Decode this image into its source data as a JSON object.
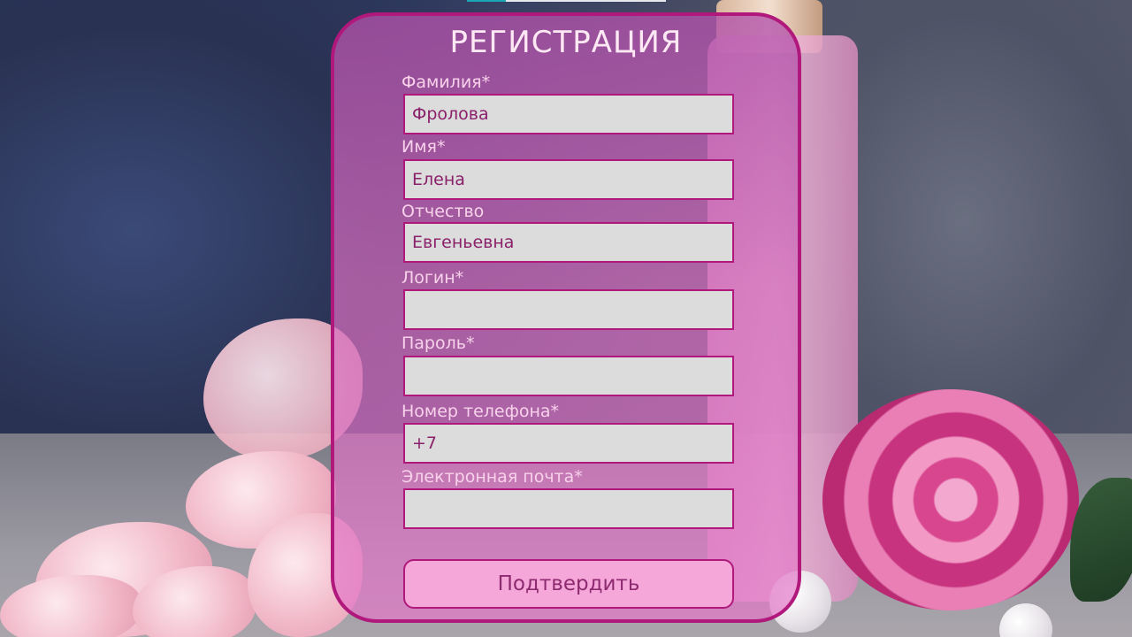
{
  "form": {
    "title": "РЕГИСТРАЦИЯ",
    "fields": [
      {
        "label": "Фамилия*",
        "value": "Фролова"
      },
      {
        "label": "Имя*",
        "value": "Елена"
      },
      {
        "label": "Отчество",
        "value": "Евгеньевна"
      },
      {
        "label": "Логин*",
        "value": ""
      },
      {
        "label": "Пароль*",
        "value": ""
      },
      {
        "label": "Номер телефона*",
        "value": "+7"
      },
      {
        "label": "Электронная почта*",
        "value": ""
      }
    ],
    "submit_label": "Подтвердить"
  },
  "colors": {
    "accent": "#b0187c",
    "panel": "#c86bb8",
    "input_bg": "#dcdcdc",
    "input_text": "#8a1f6a",
    "button_bg": "#f4a7d8"
  }
}
